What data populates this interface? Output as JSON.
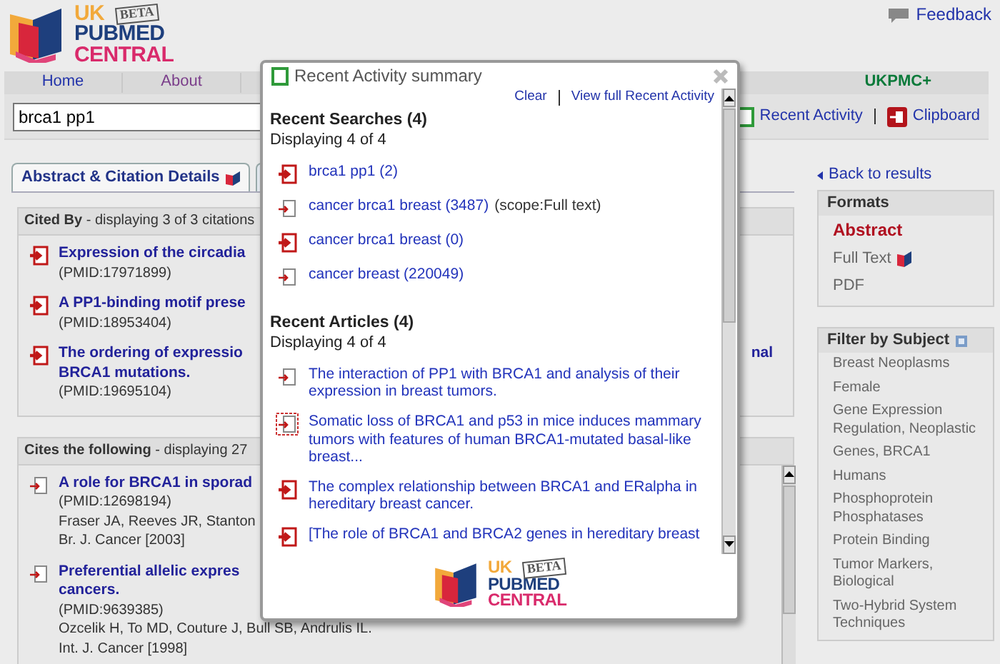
{
  "header": {
    "logo": {
      "line_1": "UK",
      "line_2": "PUBMED",
      "line_3": "CENTRAL",
      "stamp": "BETA"
    },
    "feedback": "Feedback"
  },
  "nav": {
    "items": [
      {
        "label": "Home"
      },
      {
        "label": "About"
      }
    ],
    "extra": "UKPMC+"
  },
  "search": {
    "value": "brca1 pp1"
  },
  "tools": [
    {
      "label": "Recent Activity",
      "kind": "activity"
    },
    {
      "label": "Clipboard",
      "kind": "clipboard"
    }
  ],
  "tabs": [
    {
      "label": "Abstract & Citation Details",
      "selected": true
    }
  ],
  "cited_by": {
    "title": "Cited By",
    "summary": "- displaying 3 of 3 citations",
    "items": [
      {
        "kind": "solid",
        "title": "Expression of the circadia",
        "pmid": "(PMID:17971899)"
      },
      {
        "kind": "solid",
        "title": "A PP1-binding motif prese",
        "pmid": "(PMID:18953404)"
      },
      {
        "kind": "solid",
        "title": "The ordering of expressio",
        "title_tail": "nal",
        "title_line_2": "BRCA1 mutations.",
        "pmid": "(PMID:19695104)"
      }
    ]
  },
  "cites": {
    "title": "Cites the following",
    "summary": "- displaying 27",
    "items": [
      {
        "kind": "outline",
        "title": "A role for BRCA1 in sporad",
        "pmid": "(PMID:12698194)",
        "authors": "Fraser JA, Reeves JR, Stanton",
        "journal": "Br. J. Cancer [2003]"
      },
      {
        "kind": "outline",
        "title": "Preferential allelic expres",
        "title_line_2": "cancers.",
        "pmid": "(PMID:9639385)",
        "authors": "Ozcelik H, To MD, Couture J, Bull SB, Andrulis IL.",
        "journal": "Int. J. Cancer [1998]"
      }
    ]
  },
  "sidebar": {
    "back": "Back to results",
    "formats": {
      "title": "Formats",
      "items": [
        {
          "label": "Abstract",
          "selected": true,
          "has_icon": false
        },
        {
          "label": "Full Text",
          "selected": false,
          "has_icon": true
        },
        {
          "label": "PDF",
          "selected": false,
          "has_icon": false
        }
      ]
    },
    "filter": {
      "title": "Filter by Subject",
      "items": [
        "Breast Neoplasms",
        "Female",
        "Gene Expression Regulation, Neoplastic",
        "Genes, BRCA1",
        "Humans",
        "Phosphoprotein Phosphatases",
        "Protein Binding",
        "Tumor Markers, Biological",
        "Two-Hybrid System Techniques"
      ]
    }
  },
  "dialog": {
    "title": "Recent Activity summary",
    "links": [
      "Clear",
      "View full Recent Activity"
    ],
    "searches": {
      "title": "Recent Searches (4)",
      "summary": "Displaying 4 of 4",
      "items": [
        {
          "kind": "solid",
          "text": "brca1 pp1 (2)"
        },
        {
          "kind": "outline",
          "text": "cancer brca1 breast (3487)",
          "scope": "(scope:Full text)"
        },
        {
          "kind": "solid",
          "text": "cancer brca1 breast (0)"
        },
        {
          "kind": "outline",
          "text": "cancer breast (220049)"
        }
      ]
    },
    "articles": {
      "title": "Recent Articles (4)",
      "summary": "Displaying 4 of 4",
      "items": [
        {
          "kind": "outline",
          "focused": false,
          "text": "The interaction of PP1 with BRCA1 and analysis of their expression in breast tumors."
        },
        {
          "kind": "outline",
          "focused": true,
          "text": "Somatic loss of BRCA1 and p53 in mice induces mammary tumors with features of human BRCA1-mutated basal-like breast..."
        },
        {
          "kind": "solid",
          "focused": false,
          "text": "The complex relationship between BRCA1 and ERalpha in hereditary breast cancer."
        },
        {
          "kind": "solid",
          "focused": false,
          "text": "[The role of BRCA1 and BRCA2 genes in hereditary breast"
        }
      ]
    },
    "logo": {
      "line_1": "UK",
      "line_2": "PUBMED",
      "line_3": "CENTRAL",
      "stamp": "BETA"
    }
  }
}
